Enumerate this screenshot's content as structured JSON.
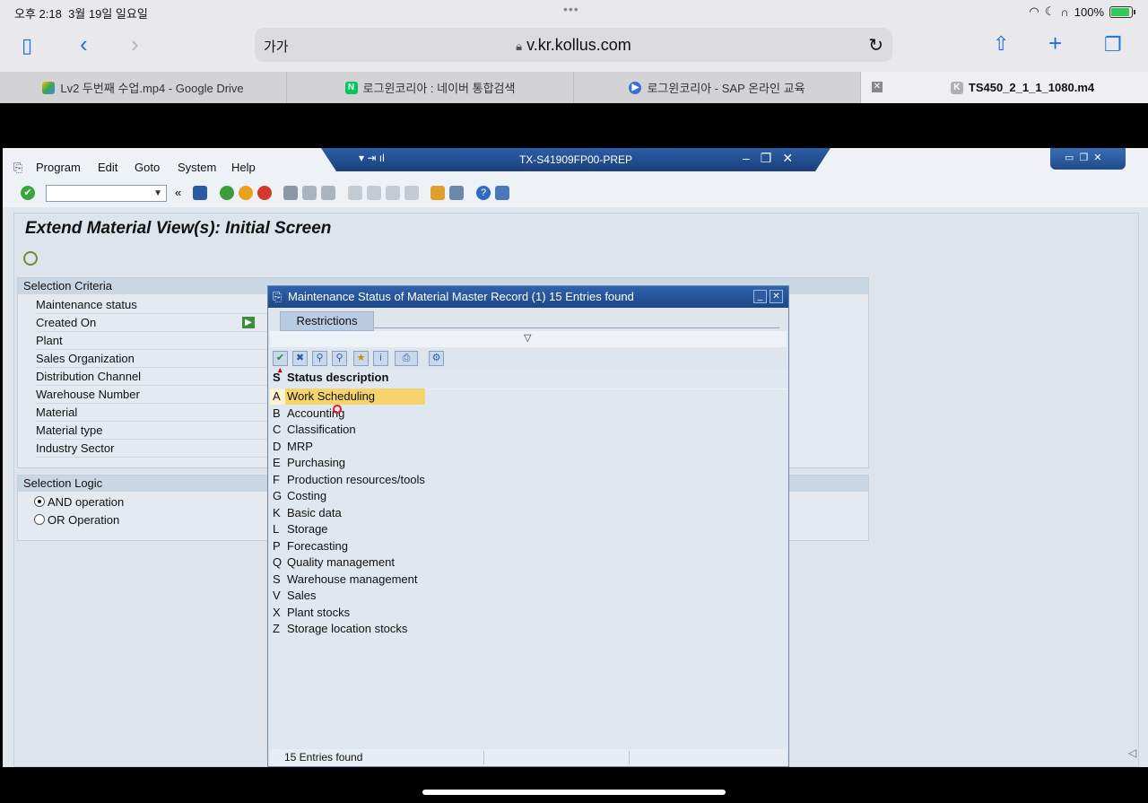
{
  "ios_status": {
    "time": "오후 2:18",
    "date": "3월 19일 일요일",
    "battery": "100%"
  },
  "safari": {
    "text_size": "가가",
    "url": "v.kr.kollus.com",
    "tabs": [
      {
        "label": "Lv2 두번째 수업.mp4 - Google Drive",
        "icon": "google-drive-icon"
      },
      {
        "label": "로그윈코리아 : 네이버 통합검색",
        "icon": "naver-icon",
        "icon_text": "N"
      },
      {
        "label": "로그윈코리아 - SAP 온라인 교육",
        "icon": "play-icon"
      },
      {
        "label": "TS450_2_1_1_1080.m4",
        "icon": "k-icon",
        "icon_text": "K"
      }
    ]
  },
  "sap": {
    "menu": [
      "Program",
      "Edit",
      "Goto",
      "System",
      "Help"
    ],
    "system_title": "TX-S41909FP00-PREP",
    "screen_title": "Extend Material View(s): Initial Screen",
    "selection_criteria": {
      "header": "Selection Criteria",
      "fields": [
        "Maintenance status",
        "Created On",
        "Plant",
        "Sales Organization",
        "Distribution Channel",
        "Warehouse Number",
        "Material",
        "Material type",
        "Industry Sector"
      ]
    },
    "selection_logic": {
      "header": "Selection Logic",
      "options": [
        {
          "label": "AND operation",
          "selected": true
        },
        {
          "label": "OR Operation",
          "selected": false
        }
      ]
    }
  },
  "popup": {
    "title": "Maintenance Status of Material Master Record (1)   15 Entries found",
    "tab": "Restrictions",
    "columns": {
      "status": "S",
      "description": "Status description"
    },
    "rows": [
      {
        "key": "A",
        "desc": "Work Scheduling"
      },
      {
        "key": "B",
        "desc": "Accounting"
      },
      {
        "key": "C",
        "desc": "Classification"
      },
      {
        "key": "D",
        "desc": "MRP"
      },
      {
        "key": "E",
        "desc": "Purchasing"
      },
      {
        "key": "F",
        "desc": "Production resources/tools"
      },
      {
        "key": "G",
        "desc": "Costing"
      },
      {
        "key": "K",
        "desc": "Basic data"
      },
      {
        "key": "L",
        "desc": "Storage"
      },
      {
        "key": "P",
        "desc": "Forecasting"
      },
      {
        "key": "Q",
        "desc": "Quality management"
      },
      {
        "key": "S",
        "desc": "Warehouse management"
      },
      {
        "key": "V",
        "desc": "Sales"
      },
      {
        "key": "X",
        "desc": "Plant stocks"
      },
      {
        "key": "Z",
        "desc": "Storage location stocks"
      }
    ],
    "selected_row_key": "A",
    "status_text": "15 Entries found"
  }
}
